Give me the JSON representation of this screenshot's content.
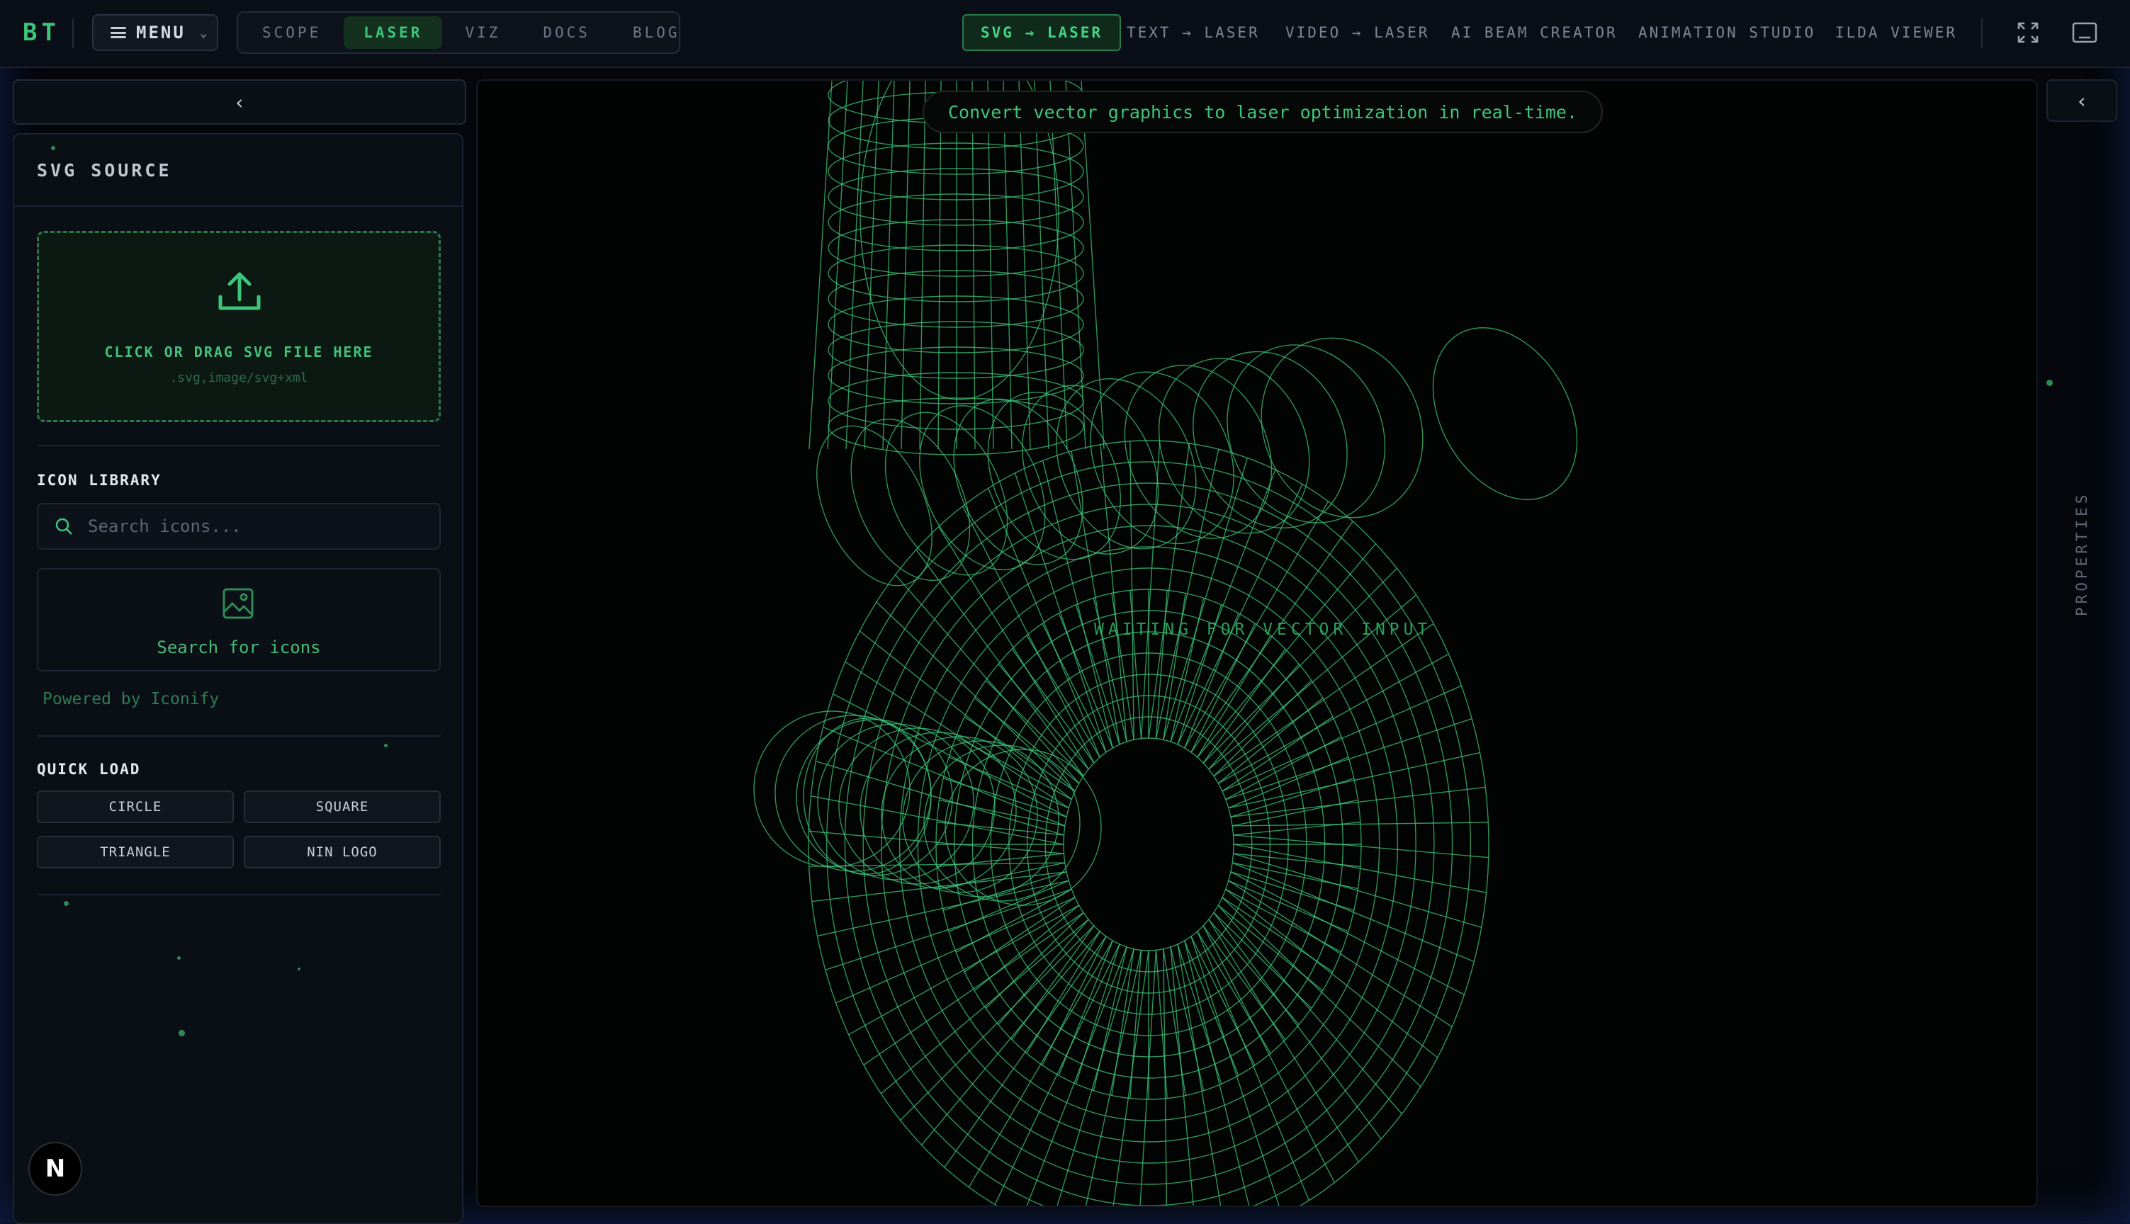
{
  "app": {
    "logo": "BT",
    "menu_label": "MENU"
  },
  "nav": {
    "tabs": [
      {
        "label": "SCOPE",
        "active": false
      },
      {
        "label": "LASER",
        "active": true
      },
      {
        "label": "VIZ",
        "active": false
      },
      {
        "label": "DOCS",
        "active": false
      },
      {
        "label": "BLOG",
        "active": false
      }
    ],
    "tools": [
      {
        "label": "SVG → LASER",
        "active": true
      },
      {
        "label": "TEXT → LASER",
        "active": false
      },
      {
        "label": "VIDEO → LASER",
        "active": false
      },
      {
        "label": "AI BEAM CREATOR",
        "active": false
      },
      {
        "label": "ANIMATION STUDIO",
        "active": false
      },
      {
        "label": "ILDA VIEWER",
        "active": false
      }
    ],
    "icons": [
      "fullscreen-icon",
      "panel-icon"
    ]
  },
  "sidebar": {
    "title": "SVG SOURCE",
    "dropzone": {
      "label": "CLICK OR DRAG SVG FILE HERE",
      "accept": ".svg,image/svg+xml"
    },
    "icon_library": {
      "title": "ICON LIBRARY",
      "search_placeholder": "Search icons...",
      "empty_label": "Search for icons",
      "powered_by": "Powered by Iconify"
    },
    "quick_load": {
      "title": "QUICK LOAD",
      "items": [
        "CIRCLE",
        "SQUARE",
        "TRIANGLE",
        "NIN LOGO"
      ]
    },
    "badge": "N"
  },
  "canvas": {
    "banner": "Convert vector graphics to laser optimization in real-time.",
    "status": "WAITING FOR VECTOR INPUT"
  },
  "properties": {
    "label": "PROPERTIES"
  },
  "colors": {
    "accent": "#3ec57a",
    "wireframe": "#3ec57a",
    "background": "#05070c"
  }
}
